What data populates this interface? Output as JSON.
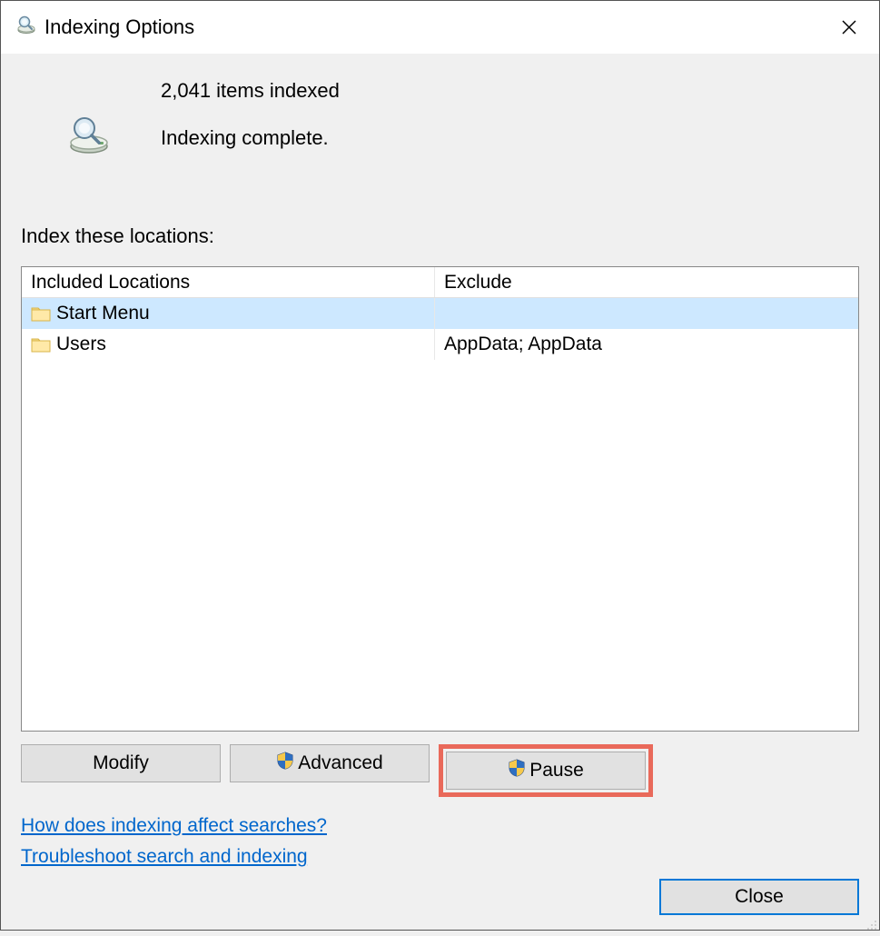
{
  "window": {
    "title": "Indexing Options"
  },
  "status": {
    "count_line": "2,041 items indexed",
    "state_line": "Indexing complete."
  },
  "section_label": "Index these locations:",
  "columns": {
    "included": "Included Locations",
    "exclude": "Exclude"
  },
  "rows": [
    {
      "name": "Start Menu",
      "exclude": "",
      "selected": true
    },
    {
      "name": "Users",
      "exclude": "AppData; AppData",
      "selected": false
    }
  ],
  "buttons": {
    "modify": "Modify",
    "advanced": "Advanced",
    "pause": "Pause",
    "close": "Close"
  },
  "links": {
    "help": "How does indexing affect searches?",
    "troubleshoot": "Troubleshoot search and indexing"
  }
}
